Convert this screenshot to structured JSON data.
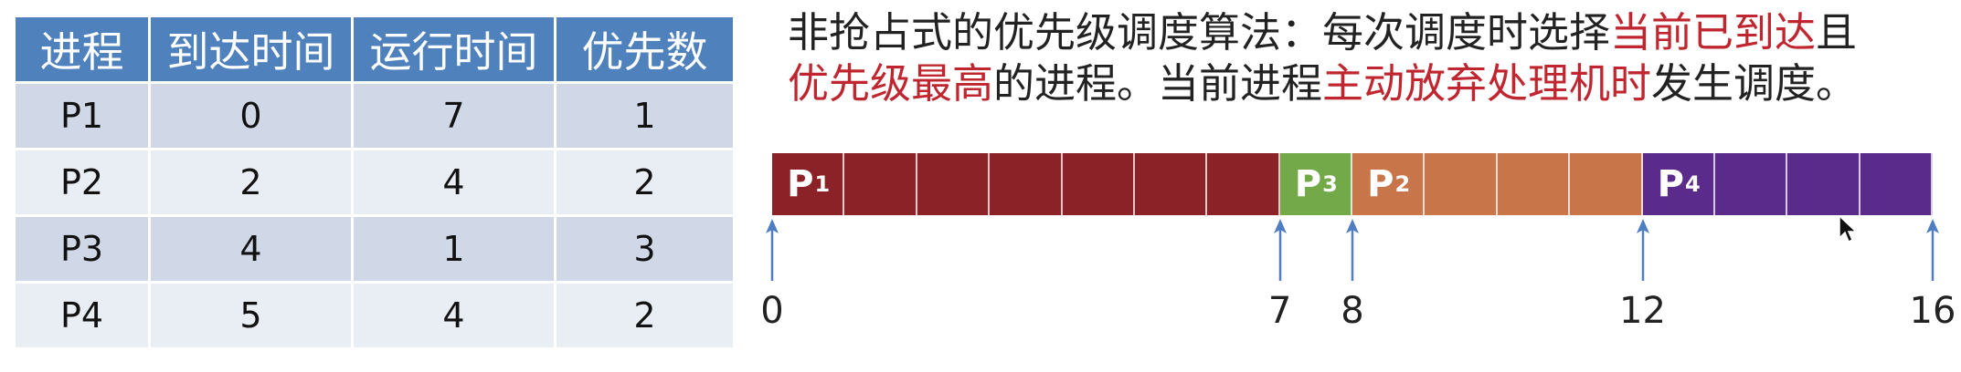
{
  "table": {
    "headers": [
      "进程",
      "到达时间",
      "运行时间",
      "优先数"
    ],
    "rows": [
      [
        "P1",
        "0",
        "7",
        "1"
      ],
      [
        "P2",
        "2",
        "4",
        "2"
      ],
      [
        "P3",
        "4",
        "1",
        "3"
      ],
      [
        "P4",
        "5",
        "4",
        "2"
      ]
    ]
  },
  "description": {
    "line1_a": "非抢占式的优先级调度算法：每次调度时选择",
    "line1_hl": "当前已到达",
    "line1_b": "且",
    "line2_hl1": "优先级最高",
    "line2_a": "的进程。当前进程",
    "line2_hl2": "主动放弃处理机时",
    "line2_b": "发生调度。"
  },
  "gantt": {
    "total_time": 16,
    "segments": [
      {
        "process": "P",
        "sub": "1",
        "start": 0,
        "end": 7,
        "color": "#8b2227"
      },
      {
        "process": "P",
        "sub": "3",
        "start": 7,
        "end": 8,
        "color": "#74a94a"
      },
      {
        "process": "P",
        "sub": "2",
        "start": 8,
        "end": 12,
        "color": "#c8754a"
      },
      {
        "process": "P",
        "sub": "4",
        "start": 12,
        "end": 16,
        "color": "#5b2b8c"
      }
    ],
    "ticks": [
      "0",
      "7",
      "8",
      "12",
      "16"
    ],
    "tick_values": [
      0,
      7,
      8,
      12,
      16
    ]
  },
  "colors": {
    "header_bg": "#4f81bd",
    "row_odd": "#d0d8e8",
    "row_even": "#e9edf4",
    "highlight_text": "#c0262f",
    "arrow": "#4f7ec2"
  },
  "icons": {
    "cursor": "mouse-pointer-icon",
    "arrow": "up-arrow-icon"
  }
}
